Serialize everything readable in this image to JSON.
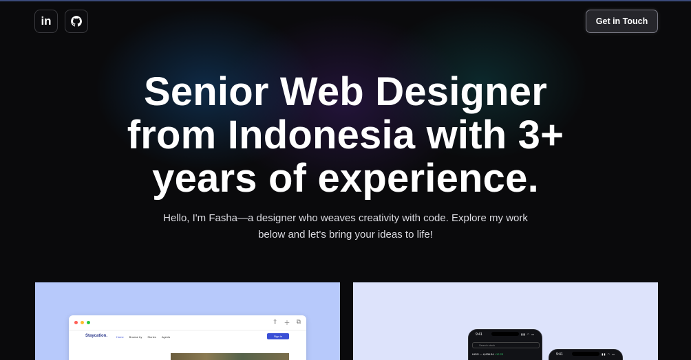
{
  "nav": {
    "linkedin_label": "in",
    "get_in_touch": "Get in Touch"
  },
  "hero": {
    "headline_lines": [
      "Senior Web Designer",
      "from Indonesia with 3+",
      "years of experience."
    ],
    "sub_lines": [
      "Hello, I'm Fasha—a designer who weaves creativity with code. Explore my work",
      "below and let's bring your ideas to life!"
    ]
  },
  "projects": [
    {
      "brand": "Staycation.",
      "nav": [
        "Home",
        "Browse by",
        "Stories",
        "Agents"
      ],
      "signin": "Sign in"
    },
    {
      "phone1": {
        "time": "9:41",
        "search_placeholder": "Search stock",
        "ticker": "IHSG",
        "ticker_value": "6,836.54",
        "ticker_change": "+12.23"
      },
      "phone2": {
        "time": "9:41"
      }
    }
  ],
  "colors": {
    "background": "#0a0a0c",
    "card_one": "#b7c9fb",
    "card_two": "#dde3fb",
    "accent": "#3a4fd6"
  }
}
